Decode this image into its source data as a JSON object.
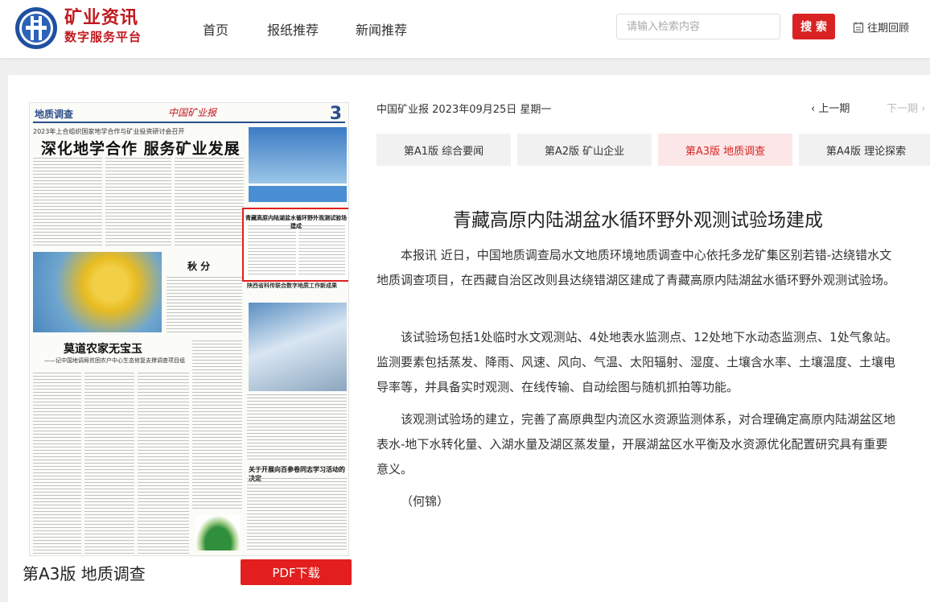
{
  "brand": {
    "line1": "矿业资讯",
    "line2": "数字服务平台"
  },
  "nav": [
    "首页",
    "报纸推荐",
    "新闻推荐"
  ],
  "search": {
    "placeholder": "请输入检索内容",
    "button": "搜 索"
  },
  "past_issues": "往期回顾",
  "newspaper": {
    "section": "地质调查",
    "paper_name": "中国矿业报",
    "page_no": "3",
    "kicker": "2023年上合组织国家地学合作与矿业投资研讨会召开",
    "headline": "深化地学合作 服务矿业发展",
    "feature": "秋 分",
    "story2": "莫道农家无宝玉",
    "story2_sub": "——记中国地调局贫困农户中心生态修复支撑调查项目组",
    "box_head": "青藏高原内陆湖盆水循环野外观测试验场建成",
    "story4": "陕西省科传联合数字地质工作新成果",
    "story3": "关于开展向百参卷同志学习活动的决定"
  },
  "edition_label": "第A3版 地质调查",
  "pdf_button": "PDF下载",
  "issue_line": "中国矿业报 2023年09月25日 星期一",
  "pager": {
    "prev": "上一期",
    "next": "下一期"
  },
  "tabs": [
    {
      "label": "第A1版 综合要闻",
      "active": false
    },
    {
      "label": "第A2版 矿山企业",
      "active": false
    },
    {
      "label": "第A3版 地质调查",
      "active": true
    },
    {
      "label": "第A4版 理论探索",
      "active": false
    }
  ],
  "article": {
    "title": "青藏高原内陆湖盆水循环野外观测试验场建成",
    "paragraphs": [
      "本报讯  近日，中国地质调查局水文地质环境地质调查中心依托多龙矿集区别若错-达绕错水文地质调查项目，在西藏自治区改则县达绕错湖区建成了青藏高原内陆湖盆水循环野外观测试验场。",
      "该试验场包括1处临时水文观测站、4处地表水监测点、12处地下水动态监测点、1处气象站。监测要素包括蒸发、降雨、风速、风向、气温、太阳辐射、湿度、土壤含水率、土壤温度、土壤电导率等，并具备实时观测、在线传输、自动绘图与随机抓拍等功能。",
      "该观测试验场的建立，完善了高原典型内流区水资源监测体系，对合理确定高原内陆湖盆区地表水-地下水转化量、入湖水量及湖区蒸发量，开展湖盆区水平衡及水资源优化配置研究具有重要意义。"
    ],
    "author": "（何锦）"
  },
  "colors": {
    "brand_red": "#c0191f",
    "accent_red": "#d92323",
    "active_tab_bg": "#fbe7e7",
    "paper_blue": "#2b4f8a"
  }
}
